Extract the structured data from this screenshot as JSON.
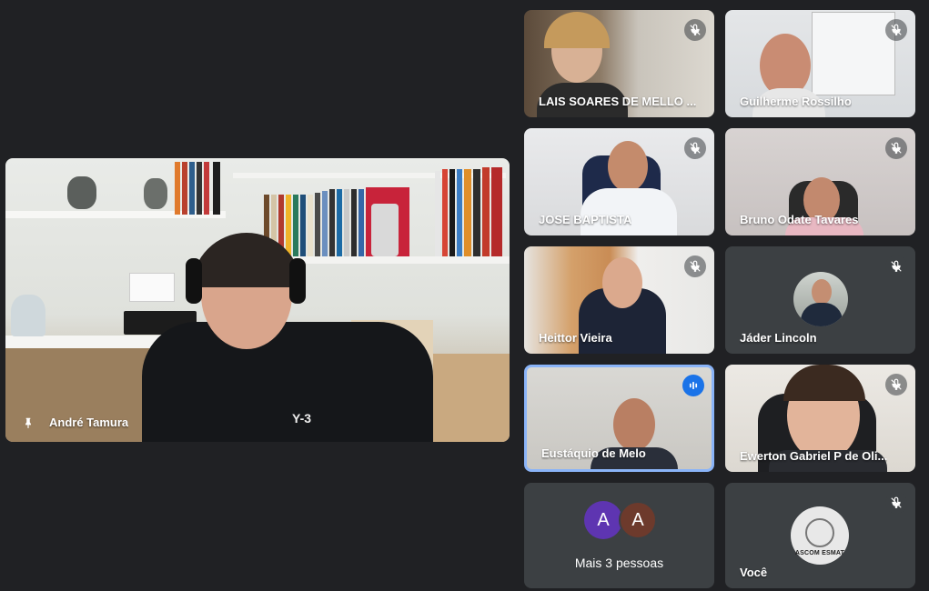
{
  "main_speaker": {
    "name": "André Tamura"
  },
  "tiles": [
    {
      "name": "LAIS SOARES DE MELLO ..."
    },
    {
      "name": "Guilherme Rossilho"
    },
    {
      "name": "JOSE BAPTISTA"
    },
    {
      "name": "Bruno Odate Tavares"
    },
    {
      "name": "Heittor Vieira"
    },
    {
      "name": "Jáder Lincoln"
    },
    {
      "name": "Eustáquio de Melo"
    },
    {
      "name": "Ewerton Gabriel P de Oli..."
    },
    {
      "name": "Mais 3 pessoas",
      "avatars": [
        "A",
        "A"
      ]
    },
    {
      "name": "Você",
      "badge_text": "ASCOM ESMAT"
    }
  ],
  "icons": {
    "mic_muted": "mic-off-icon",
    "pinned": "pin-icon",
    "speaking": "audio-level-icon"
  },
  "colors": {
    "background": "#202124",
    "tile": "#3c4043",
    "speaking_border": "#8ab4f8",
    "speaking_badge": "#1a73e8"
  }
}
